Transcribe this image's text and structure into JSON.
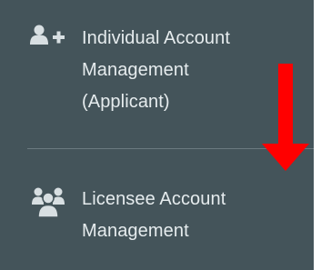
{
  "menu": {
    "items": [
      {
        "icon": "user-plus-icon",
        "lines": [
          "Individual Account",
          "Management",
          "(Applicant)"
        ]
      },
      {
        "icon": "users-group-icon",
        "lines": [
          "Licensee Account",
          "Management"
        ]
      }
    ]
  },
  "annotation": {
    "arrow_icon": "down-arrow-icon",
    "arrow_color": "#ff0000"
  },
  "colors": {
    "panel_background": "#44545a",
    "text": "#e6ecee",
    "icon": "#d8dfe2",
    "divider": "#6b7a80"
  }
}
